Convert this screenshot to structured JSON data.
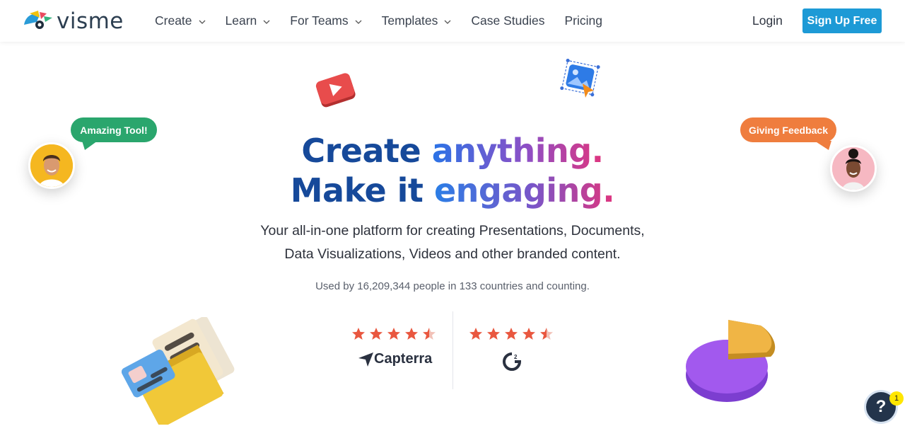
{
  "brand": {
    "name": "visme",
    "accent": "#1d9ad6"
  },
  "nav": {
    "items": [
      {
        "label": "Create",
        "dropdown": true
      },
      {
        "label": "Learn",
        "dropdown": true
      },
      {
        "label": "For Teams",
        "dropdown": true
      },
      {
        "label": "Templates",
        "dropdown": true
      },
      {
        "label": "Case Studies",
        "dropdown": false
      },
      {
        "label": "Pricing",
        "dropdown": false
      }
    ],
    "login": "Login",
    "signup": "Sign Up Free"
  },
  "hero": {
    "line1_a": "Create ",
    "line1_b": "anything.",
    "line2_a": "Make it ",
    "line2_b": "engaging.",
    "subtitle_1": "Your all-in-one platform for creating Presentations, Documents,",
    "subtitle_2": "Data Visualizations, Videos and other branded content.",
    "usage": "Used by 16,209,344 people in 133 countries and counting."
  },
  "ratings": [
    {
      "source": "Capterra",
      "stars": 4.5
    },
    {
      "source": "G2",
      "stars": 4.5
    }
  ],
  "bubbles": {
    "left": "Amazing Tool!",
    "right": "Giving Feedback"
  },
  "help": {
    "label": "?",
    "badge": "1"
  },
  "colors": {
    "headline_dark": "#16499a",
    "green_bubble": "#2aa66d",
    "orange_bubble": "#ef7d3e",
    "star": "#e9573f"
  },
  "icons": [
    "play-icon",
    "image-icon",
    "folder-illustration",
    "pie-chart-illustration",
    "chevron-down-icon",
    "star-icon",
    "capterra-logo-icon",
    "g2-logo-icon",
    "help-icon"
  ]
}
